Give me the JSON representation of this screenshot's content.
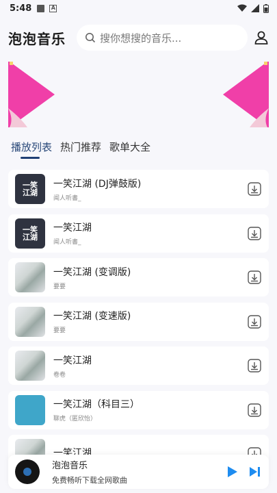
{
  "status": {
    "time": "5:48"
  },
  "header": {
    "title": "泡泡音乐",
    "search_placeholder": "搜你想搜的音乐..."
  },
  "tabs": [
    {
      "label": "播放列表",
      "active": true
    },
    {
      "label": "热门推荐",
      "active": false
    },
    {
      "label": "歌单大全",
      "active": false
    }
  ],
  "songs": [
    {
      "title": "一笑江湖 (DJ弹鼓版)",
      "artist": "闻人听書_",
      "cover": "dark"
    },
    {
      "title": "一笑江湖",
      "artist": "闻人听書_",
      "cover": "dark"
    },
    {
      "title": "一笑江湖 (变调版)",
      "artist": "要要",
      "cover": "ink"
    },
    {
      "title": "一笑江湖 (变速版)",
      "artist": "要要",
      "cover": "ink"
    },
    {
      "title": "一笑江湖",
      "artist": "卷卷",
      "cover": "ink"
    },
    {
      "title": "一笑江湖（科目三）",
      "artist": "聊虎（匿欣怡）",
      "cover": "blue"
    },
    {
      "title": "一笑江湖",
      "artist": "",
      "cover": "ink"
    }
  ],
  "player": {
    "title": "泡泡音乐",
    "subtitle": "免费畅听下载全网歌曲"
  },
  "colors": {
    "accent": "#1f3f74",
    "play": "#1e8cf0",
    "banner": "#f03fa8"
  }
}
